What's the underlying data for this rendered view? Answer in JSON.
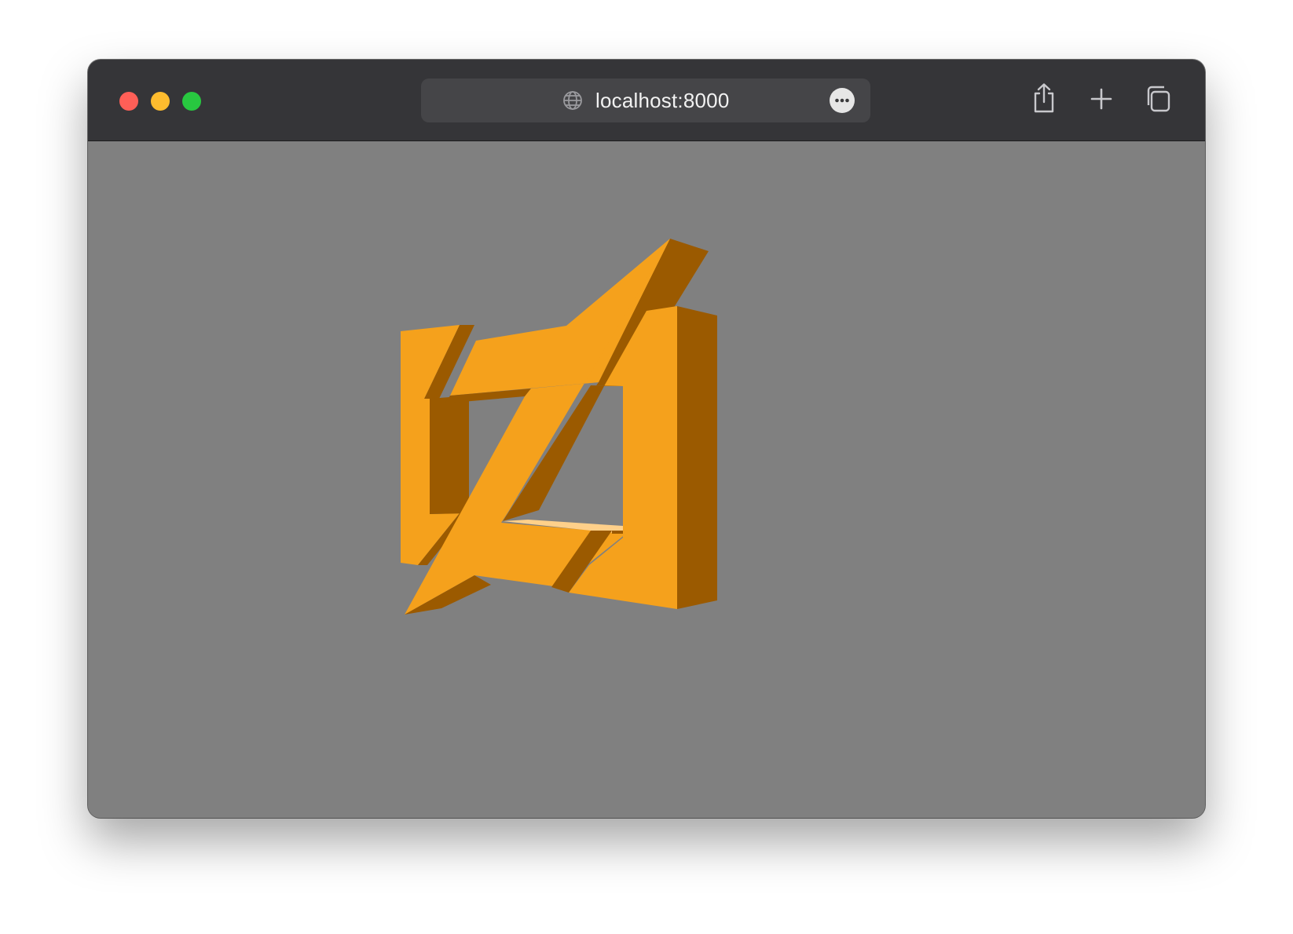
{
  "window": {
    "controls": {
      "close_color": "#ff5f57",
      "minimize_color": "#febc2e",
      "maximize_color": "#28c840"
    }
  },
  "toolbar": {
    "address": "localhost:8000",
    "address_icon": "globe-icon",
    "more_icon": "ellipsis-icon",
    "share_icon": "share-icon",
    "new_tab_icon": "plus-icon",
    "tabs_icon": "tab-overview-icon"
  },
  "page": {
    "background_color": "#808080",
    "logo": {
      "description_icon": "orange-3d-logo",
      "face_color": "#f5a11c",
      "side_color": "#9b5a00",
      "highlight_color": "#ffd08a"
    }
  }
}
